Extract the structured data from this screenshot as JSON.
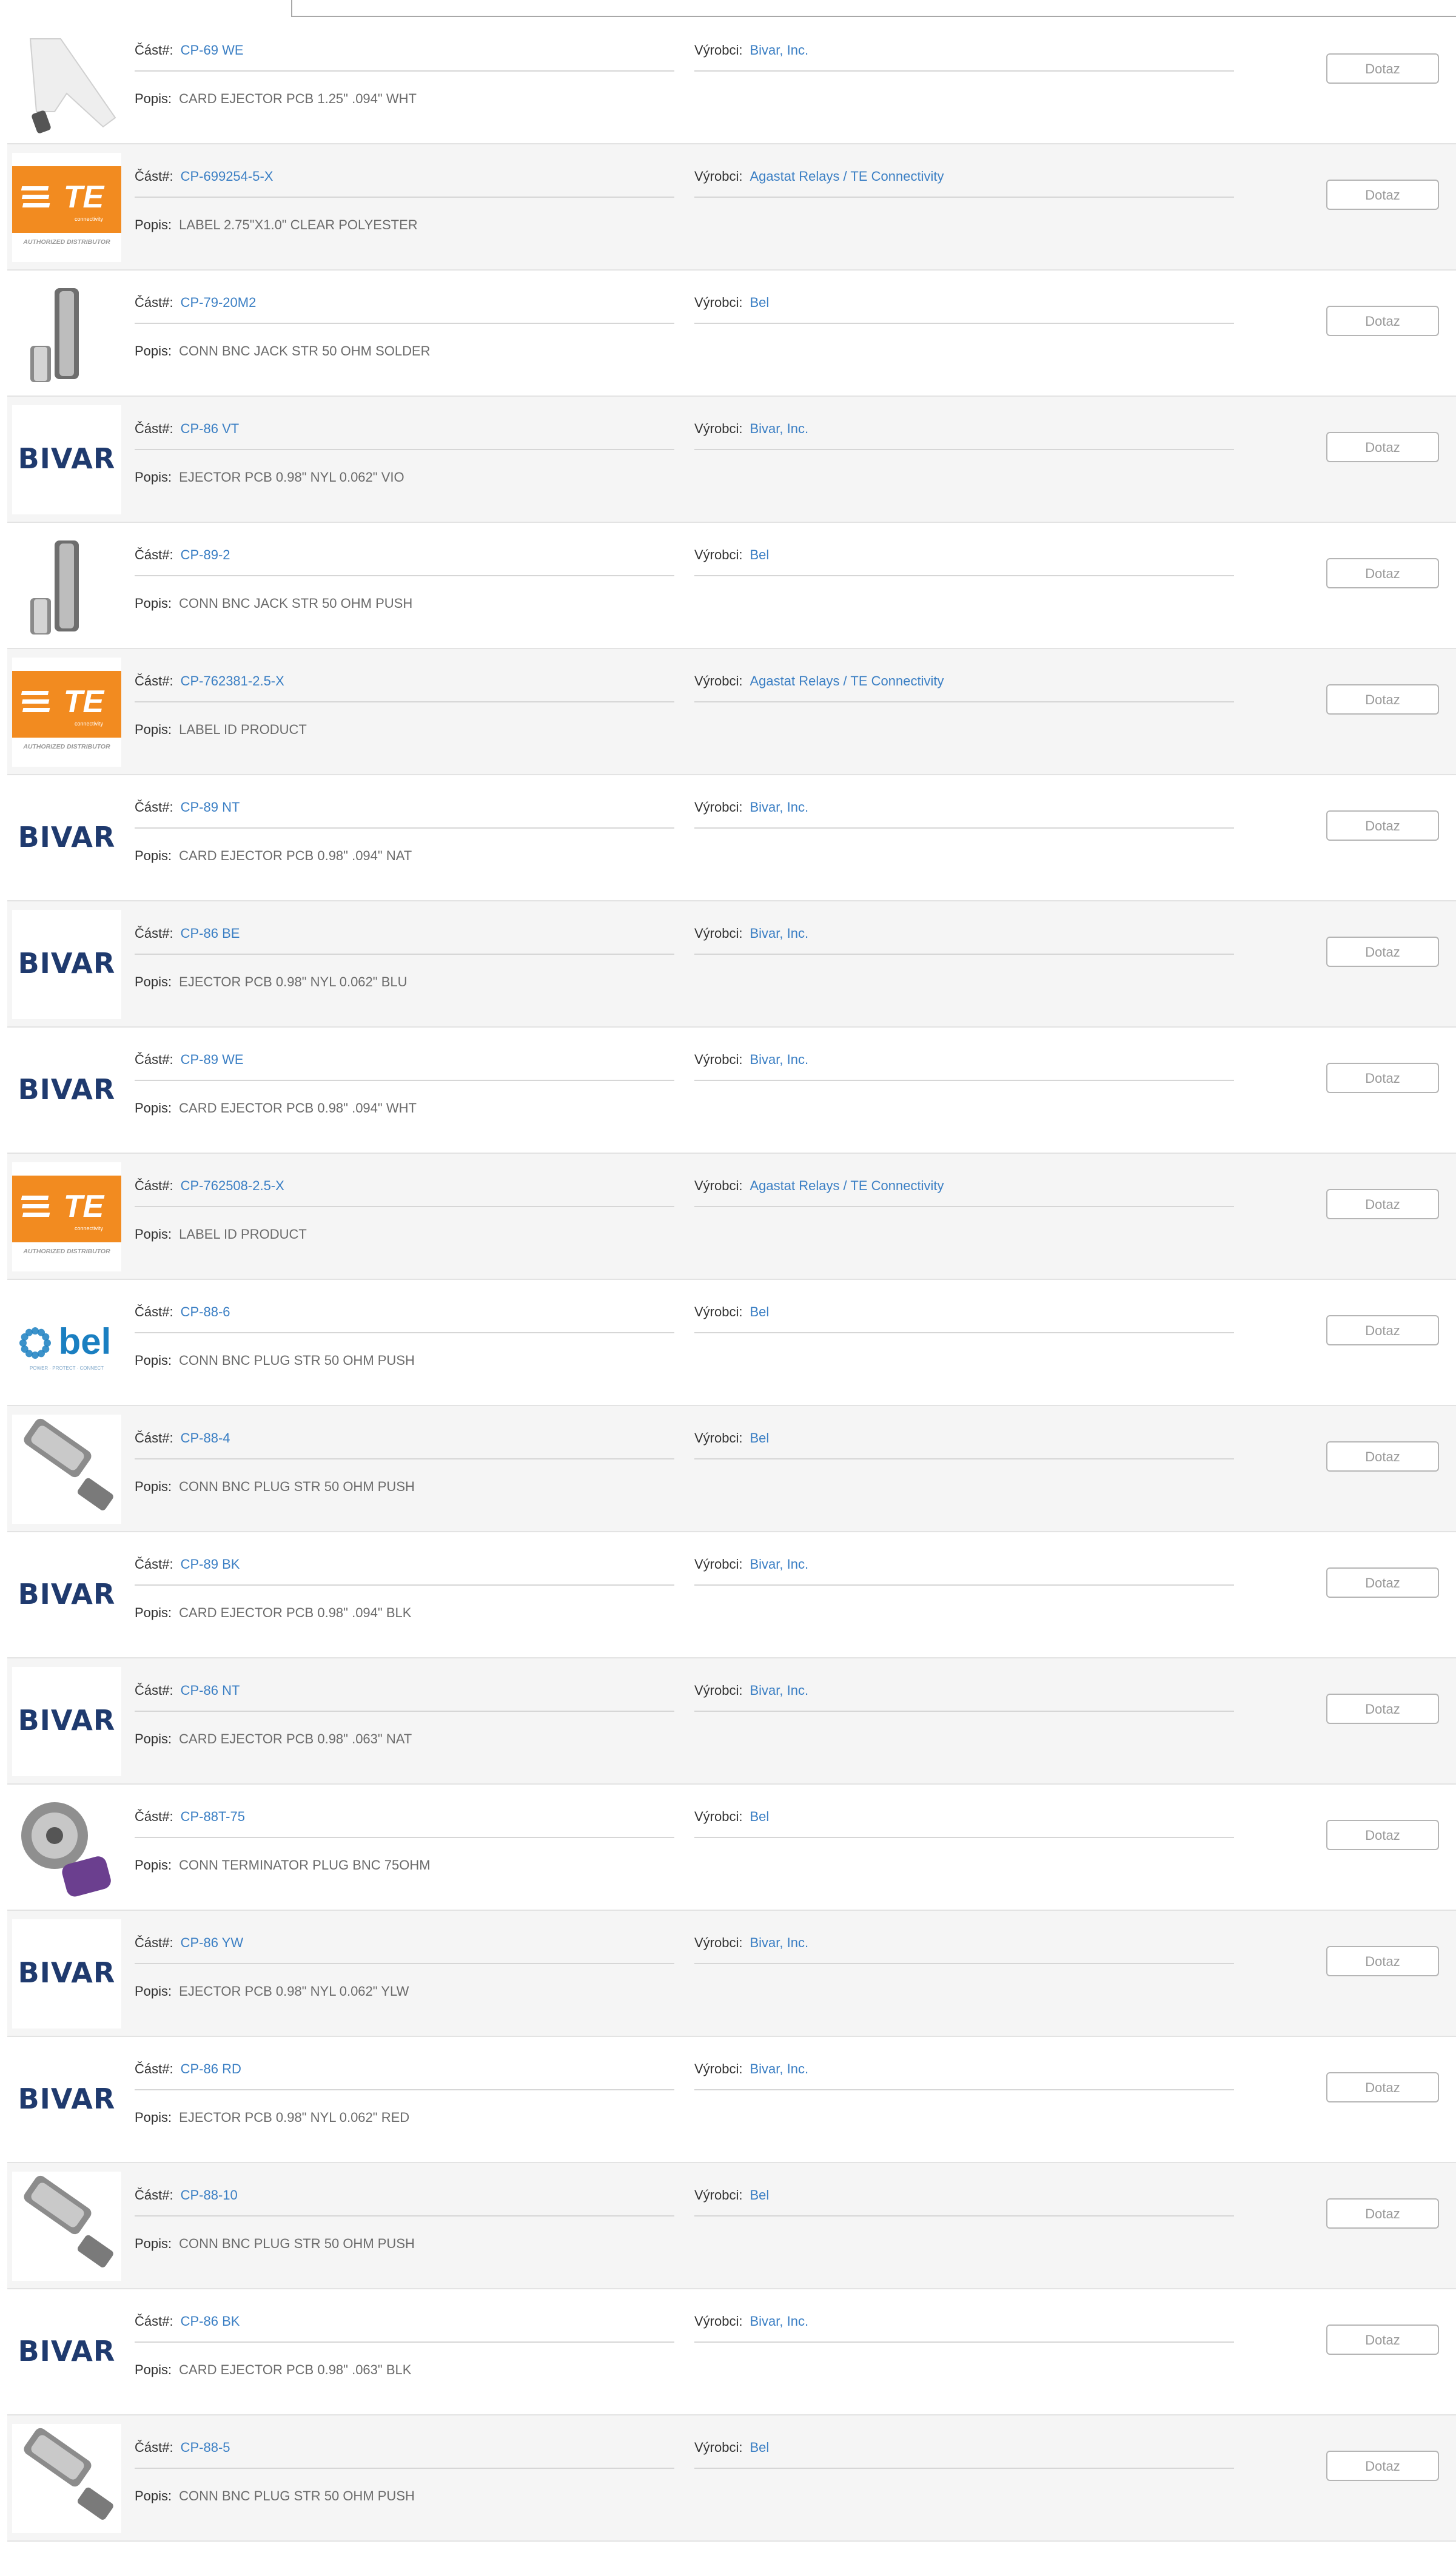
{
  "labels": {
    "part": "Část#:",
    "manufacturer": "Výrobci:",
    "description": "Popis:",
    "inquiry": "Dotaz"
  },
  "te_logo": {
    "text": "TE",
    "sub": "connectivity",
    "caption": "AUTHORIZED DISTRIBUTOR"
  },
  "bivar_logo": {
    "text": "BIVAR"
  },
  "bel_logo": {
    "text": "bel",
    "sub": "POWER · PROTECT · CONNECT"
  },
  "colors": {
    "link": "#3b7fc4",
    "te_orange": "#f28b20",
    "bivar_navy": "#1f3a6e",
    "bel_blue": "#1a7fc1"
  },
  "rows": [
    {
      "part": "CP-69 WE",
      "manufacturer": "Bivar, Inc.",
      "description": "CARD EJECTOR PCB 1.25\" .094\" WHT",
      "image": "white-card-ejector-photo"
    },
    {
      "part": "CP-699254-5-X",
      "manufacturer": "Agastat Relays / TE Connectivity",
      "description": "LABEL 2.75\"X1.0\" CLEAR POLYESTER",
      "image": "te-logo"
    },
    {
      "part": "CP-79-20M2",
      "manufacturer": "Bel",
      "description": "CONN BNC JACK STR 50 OHM SOLDER",
      "image": "bnc-jack-photo"
    },
    {
      "part": "CP-86 VT",
      "manufacturer": "Bivar, Inc.",
      "description": "EJECTOR PCB 0.98\" NYL 0.062\" VIO",
      "image": "bivar-logo"
    },
    {
      "part": "CP-89-2",
      "manufacturer": "Bel",
      "description": "CONN BNC JACK STR 50 OHM PUSH",
      "image": "bnc-jack-photo"
    },
    {
      "part": "CP-762381-2.5-X",
      "manufacturer": "Agastat Relays / TE Connectivity",
      "description": "LABEL ID PRODUCT",
      "image": "te-logo"
    },
    {
      "part": "CP-89 NT",
      "manufacturer": "Bivar, Inc.",
      "description": "CARD EJECTOR PCB 0.98\" .094\" NAT",
      "image": "bivar-logo"
    },
    {
      "part": "CP-86 BE",
      "manufacturer": "Bivar, Inc.",
      "description": "EJECTOR PCB 0.98\" NYL 0.062\" BLU",
      "image": "bivar-logo"
    },
    {
      "part": "CP-89 WE",
      "manufacturer": "Bivar, Inc.",
      "description": "CARD EJECTOR PCB 0.98\" .094\" WHT",
      "image": "bivar-logo"
    },
    {
      "part": "CP-762508-2.5-X",
      "manufacturer": "Agastat Relays / TE Connectivity",
      "description": "LABEL ID PRODUCT",
      "image": "te-logo"
    },
    {
      "part": "CP-88-6",
      "manufacturer": "Bel",
      "description": "CONN BNC PLUG STR 50 OHM PUSH",
      "image": "bel-logo"
    },
    {
      "part": "CP-88-4",
      "manufacturer": "Bel",
      "description": "CONN BNC PLUG STR 50 OHM PUSH",
      "image": "bnc-plug-photo"
    },
    {
      "part": "CP-89 BK",
      "manufacturer": "Bivar, Inc.",
      "description": "CARD EJECTOR PCB 0.98\" .094\" BLK",
      "image": "bivar-logo"
    },
    {
      "part": "CP-86 NT",
      "manufacturer": "Bivar, Inc.",
      "description": "CARD EJECTOR PCB 0.98\" .063\" NAT",
      "image": "bivar-logo"
    },
    {
      "part": "CP-88T-75",
      "manufacturer": "Bel",
      "description": "CONN TERMINATOR PLUG BNC 75OHM",
      "image": "bnc-terminator-photo"
    },
    {
      "part": "CP-86 YW",
      "manufacturer": "Bivar, Inc.",
      "description": "EJECTOR PCB 0.98\" NYL 0.062\" YLW",
      "image": "bivar-logo"
    },
    {
      "part": "CP-86 RD",
      "manufacturer": "Bivar, Inc.",
      "description": "EJECTOR PCB 0.98\" NYL 0.062\" RED",
      "image": "bivar-logo"
    },
    {
      "part": "CP-88-10",
      "manufacturer": "Bel",
      "description": "CONN BNC PLUG STR 50 OHM PUSH",
      "image": "bnc-plug-photo"
    },
    {
      "part": "CP-86 BK",
      "manufacturer": "Bivar, Inc.",
      "description": "CARD EJECTOR PCB 0.98\" .063\" BLK",
      "image": "bivar-logo"
    },
    {
      "part": "CP-88-5",
      "manufacturer": "Bel",
      "description": "CONN BNC PLUG STR 50 OHM PUSH",
      "image": "bnc-plug-photo"
    }
  ]
}
